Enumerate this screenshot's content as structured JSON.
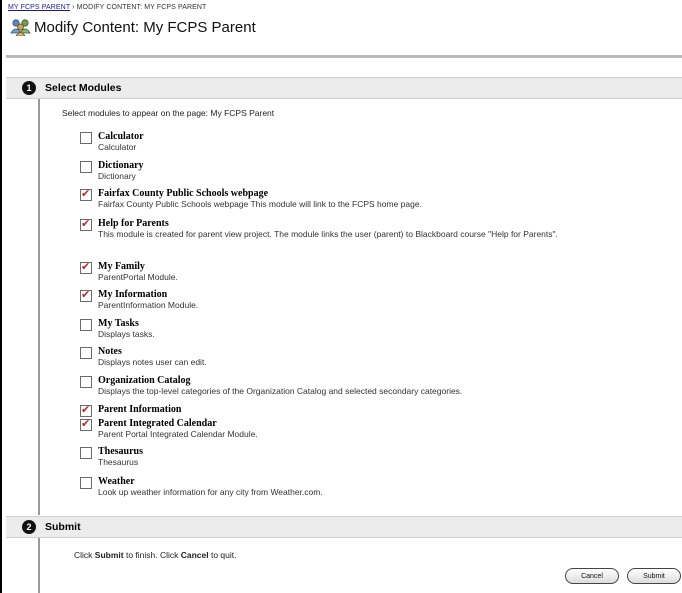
{
  "breadcrumb": {
    "root": "MY FCPS PARENT",
    "separator": "›",
    "current": "MODIFY CONTENT: MY FCPS PARENT"
  },
  "page": {
    "title": "Modify Content: My FCPS Parent",
    "icon": "people-group-icon"
  },
  "steps": [
    {
      "number": "1",
      "label": "Select Modules"
    },
    {
      "number": "2",
      "label": "Submit"
    }
  ],
  "intro": "Select modules to appear on the page: My FCPS Parent",
  "modules": [
    {
      "name": "Calculator",
      "description": "Calculator",
      "checked": false
    },
    {
      "name": "Dictionary",
      "description": "Dictionary",
      "checked": false
    },
    {
      "name": "Fairfax County Public Schools webpage",
      "description": "Fairfax County Public Schools webpage This module will link to the FCPS home page.",
      "checked": true
    },
    {
      "name": "Help for Parents",
      "description": "This module is created for parent view project. The module links the user (parent) to Blackboard course \"Help for Parents\".",
      "checked": true
    },
    {
      "name": "My Family",
      "description": "ParentPortal Module.",
      "checked": true
    },
    {
      "name": "My Information",
      "description": "ParentInformation Module.",
      "checked": true
    },
    {
      "name": "My Tasks",
      "description": "Displays tasks.",
      "checked": false
    },
    {
      "name": "Notes",
      "description": "Displays notes user can edit.",
      "checked": false
    },
    {
      "name": "Organization Catalog",
      "description": "Displays the top-level categories of the Organization Catalog and selected secondary categories.",
      "checked": false
    },
    {
      "name": "Parent Information",
      "description": "",
      "checked": true
    },
    {
      "name": "Parent Integrated Calendar",
      "description": "Parent Portal Integrated Calendar Module.",
      "checked": true
    },
    {
      "name": "Thesaurus",
      "description": "Thesaurus",
      "checked": false
    },
    {
      "name": "Weather",
      "description": "Look up weather information for any city from Weather.com.",
      "checked": false
    }
  ],
  "submit_section": {
    "text_prefix": "Click ",
    "submit_word": "Submit",
    "text_middle": " to finish. Click ",
    "cancel_word": "Cancel",
    "text_suffix": " to quit."
  },
  "buttons": {
    "cancel": "Cancel",
    "submit": "Submit"
  },
  "colors": {
    "check_mark": "#c4242b",
    "step_bar": "#ececec",
    "link": "#1a1aa6"
  }
}
